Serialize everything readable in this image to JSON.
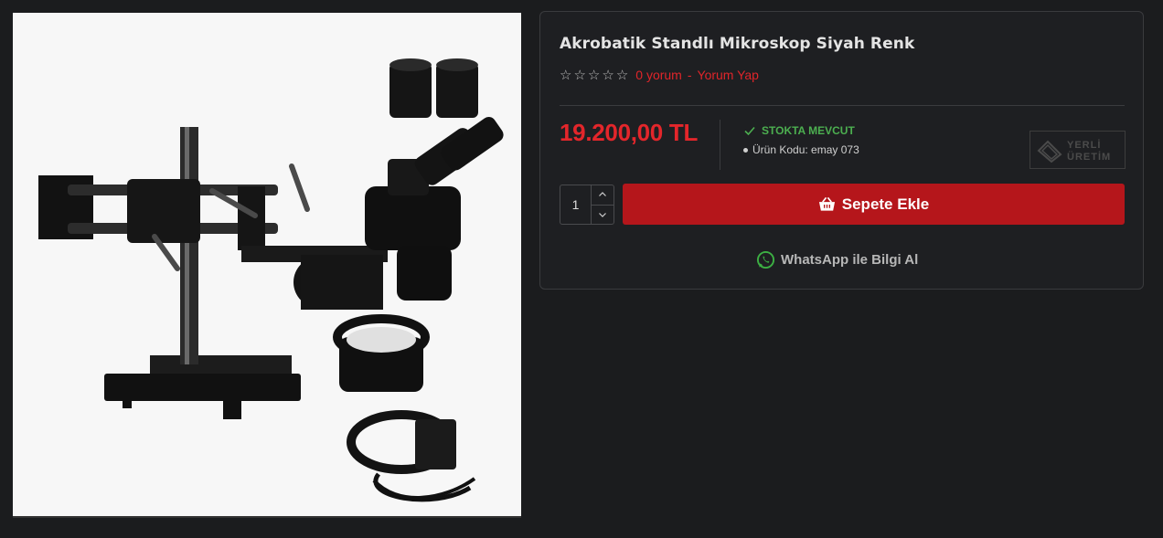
{
  "product": {
    "title": "Akrobatik Standlı Mikroskop Siyah Renk",
    "image_alt": "microscope-product-photo",
    "price": "19.200,00 TL",
    "rating": {
      "stars": 0,
      "max": 5,
      "reviews_label": "0 yorum",
      "separator": "-",
      "write_review_label": "Yorum Yap"
    },
    "stock_label": "STOKTA MEVCUT",
    "code_label": "Ürün Kodu: emay 073",
    "badge": {
      "line1": "YERLİ",
      "line2": "ÜRETİM"
    },
    "quantity": "1"
  },
  "actions": {
    "add_to_cart_label": "Sepete Ekle",
    "whatsapp_label": "WhatsApp ile Bilgi Al"
  },
  "icons": {
    "star": "star-outline-icon",
    "check": "check-icon",
    "basket": "basket-icon",
    "whatsapp": "whatsapp-icon",
    "up": "chevron-up-icon",
    "down": "chevron-down-icon"
  },
  "colors": {
    "background": "#1b1c1e",
    "price": "#e3262b",
    "button": "#b5161b",
    "stock": "#4caf50",
    "link": "#e0252a"
  }
}
